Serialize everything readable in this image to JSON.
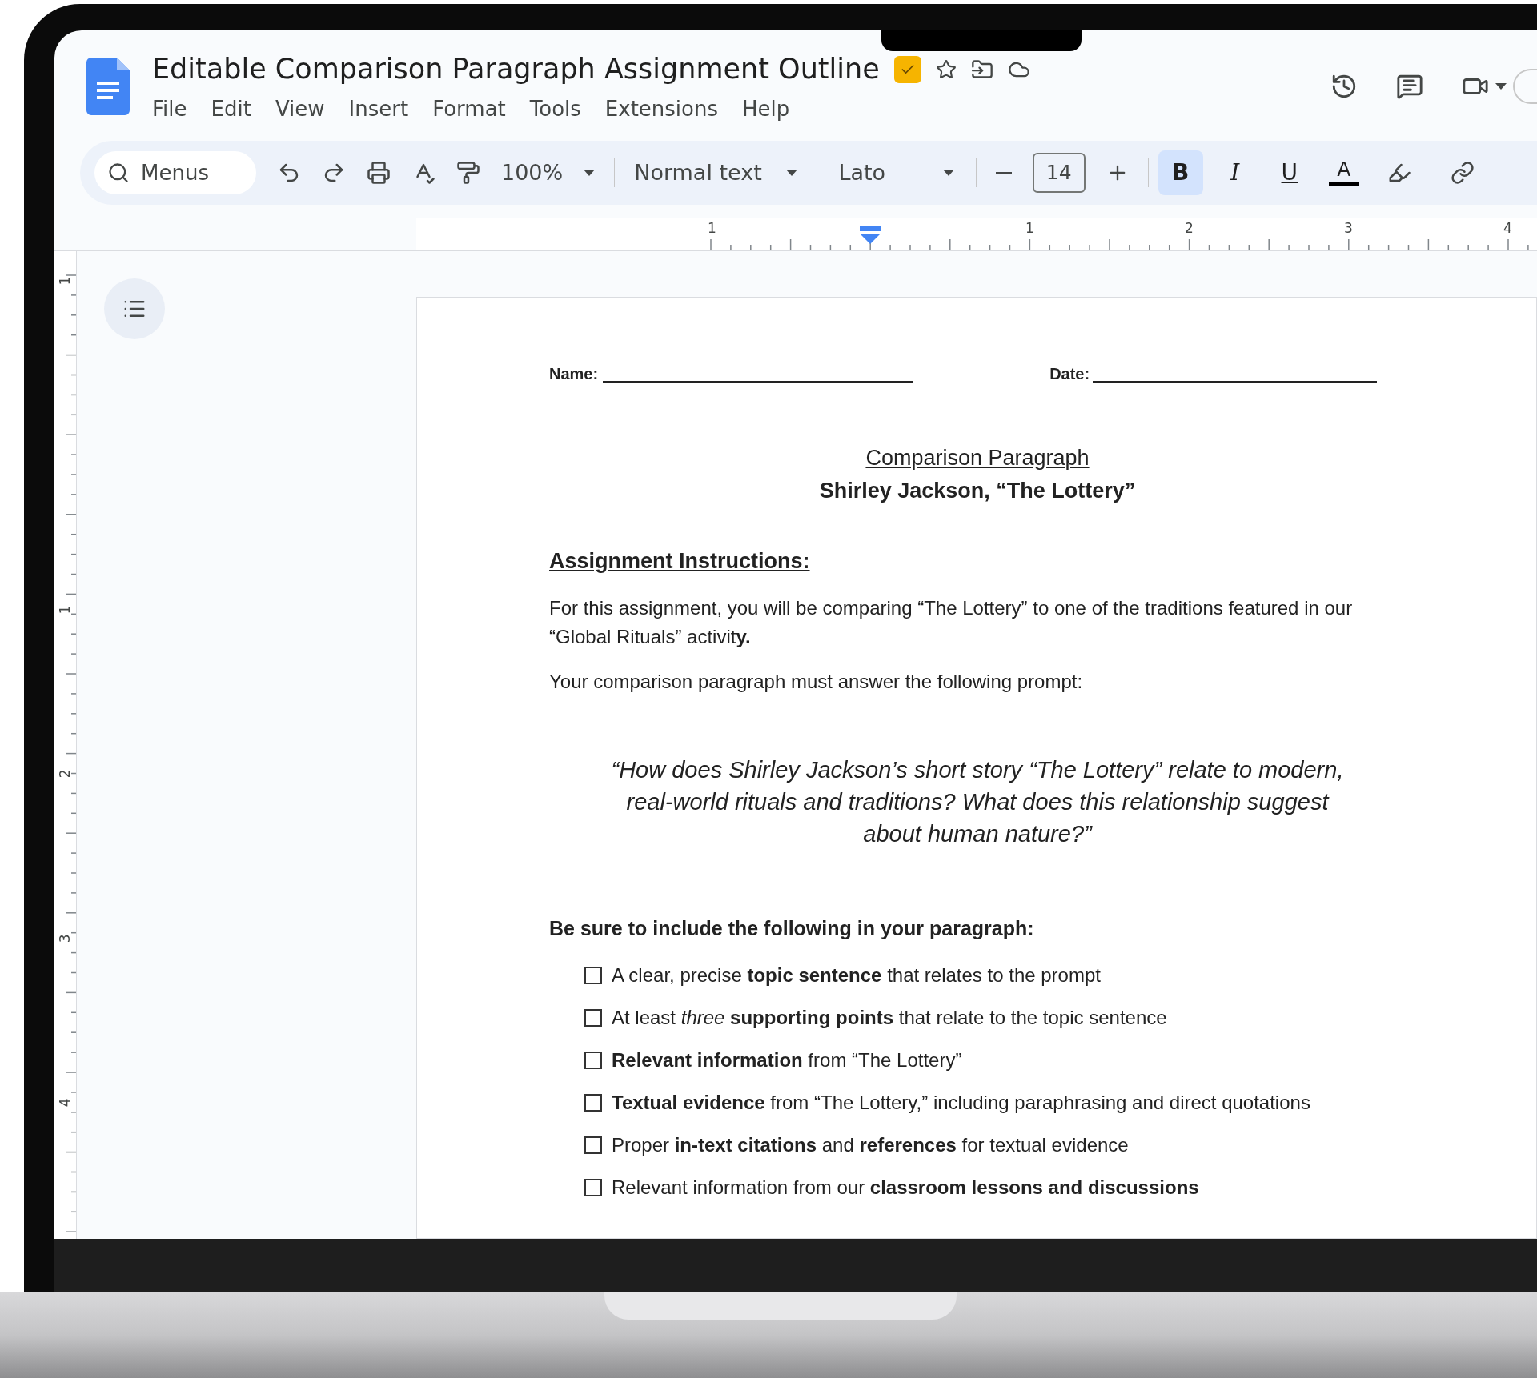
{
  "document_title": "Editable Comparison Paragraph Assignment Outline",
  "menu": [
    "File",
    "Edit",
    "View",
    "Insert",
    "Format",
    "Tools",
    "Extensions",
    "Help"
  ],
  "toolbar": {
    "search": {
      "placeholder": "Menus"
    },
    "zoom": "100%",
    "style": "Normal text",
    "font": "Lato",
    "font_size": "14",
    "format_buttons": [
      {
        "kind": "bold",
        "label": "B",
        "selected": true
      },
      {
        "kind": "italic",
        "label": "I",
        "selected": false
      },
      {
        "kind": "underline",
        "label": "U",
        "selected": false
      }
    ],
    "text_color": {
      "label": "A",
      "color": "#000000"
    }
  },
  "ruler_labels": [
    "1",
    "1",
    "2",
    "3",
    "4"
  ],
  "vertical_ruler_labels": [
    "1",
    "1",
    "2",
    "3",
    "4"
  ],
  "document": {
    "name_label": "Name:",
    "date_label": "Date:",
    "heading": "Comparison Paragraph",
    "subheading": "Shirley Jackson, “The Lottery”",
    "section_heading": "Assignment Instructions:",
    "paragraphs": [
      "For this assignment, you will be comparing “The Lottery” to one of the traditions featured in our “Global Rituals” activit**y.**",
      "Your comparison paragraph must answer the following prompt:"
    ],
    "prompt": "“How does Shirley Jackson’s short story “The Lottery” relate to modern, real-world rituals and traditions?  What does this relationship suggest about human nature?”",
    "checklist_heading": "Be sure to include the following in your paragraph:",
    "checklist": [
      {
        "text": "A clear, precise **topic sentence** that relates to the prompt",
        "checked": false
      },
      {
        "text": "At least *three* **supporting points** that relate to the topic sentence",
        "checked": false
      },
      {
        "text": "**Relevant information** from “The Lottery”",
        "checked": false
      },
      {
        "text": "**Textual evidence** from “The Lottery,” including paraphrasing and direct quotations",
        "checked": false
      },
      {
        "text": "Proper **in-text citations** and **references** for textual evidence",
        "checked": false
      },
      {
        "text": "Relevant information from our **classroom lessons and discussions**",
        "checked": false
      }
    ]
  }
}
